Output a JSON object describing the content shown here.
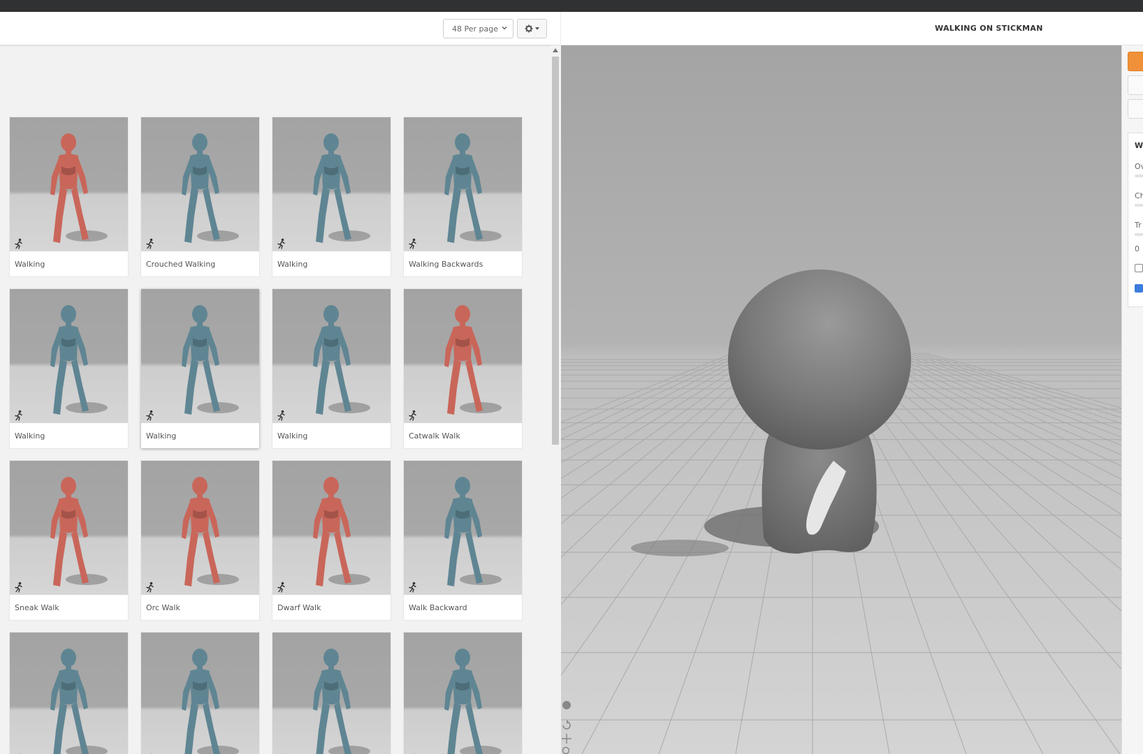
{
  "toolbar": {
    "per_page": "48 Per page"
  },
  "viewer": {
    "title": "WALKING ON STICKMAN",
    "settings_panel": {
      "title": "W",
      "rows": [
        "Ov",
        "Ch",
        "Tr"
      ],
      "value": "0"
    }
  },
  "animations": [
    {
      "label": "Walking",
      "figure": "female-red"
    },
    {
      "label": "Crouched Walking",
      "figure": "male-blue"
    },
    {
      "label": "Walking",
      "figure": "male-blue"
    },
    {
      "label": "Walking Backwards",
      "figure": "male-blue"
    },
    {
      "label": "Walking",
      "figure": "male-blue"
    },
    {
      "label": "Walking",
      "figure": "male-blue"
    },
    {
      "label": "Walking",
      "figure": "male-blue"
    },
    {
      "label": "Catwalk Walk",
      "figure": "female-red"
    },
    {
      "label": "Sneak Walk",
      "figure": "female-red"
    },
    {
      "label": "Orc Walk",
      "figure": "female-red"
    },
    {
      "label": "Dwarf Walk",
      "figure": "female-red"
    },
    {
      "label": "Walk Backward",
      "figure": "male-blue"
    },
    {
      "label": "",
      "figure": "male-blue"
    },
    {
      "label": "",
      "figure": "male-blue"
    },
    {
      "label": "",
      "figure": "male-blue"
    },
    {
      "label": "",
      "figure": "male-blue"
    }
  ],
  "colors": {
    "accent": "#f0913a",
    "figure_red": "#c9665a",
    "figure_blue": "#5f8593",
    "checkbox": "#3b7ddd"
  },
  "icons": {
    "card": "running-man-icon",
    "toolbar": "gear-icon"
  }
}
